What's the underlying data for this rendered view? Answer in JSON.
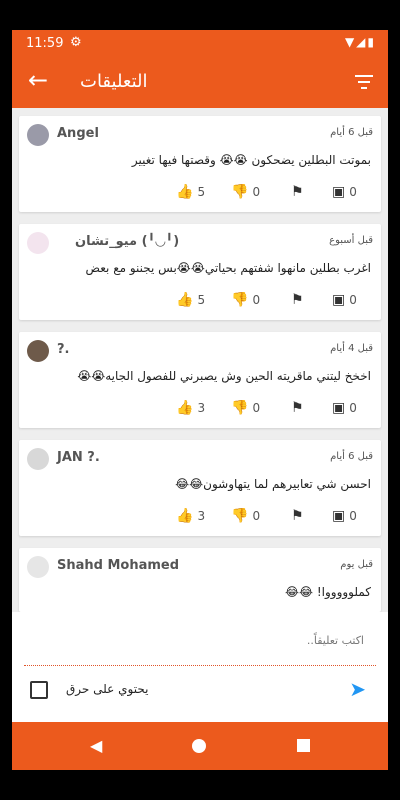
{
  "status_bar": {
    "time": "11:59",
    "system_icons": "▼◢▮"
  },
  "app_bar": {
    "title": "التعليقات"
  },
  "comments": [
    {
      "name": "Angel",
      "time_ago": "قبل 6 أيام",
      "text": "بموتت البطلين يضحكون 😭😭 وقصتها فيها تغيير",
      "likes": "5",
      "dislikes": "0",
      "replies": "0"
    },
    {
      "name": "ميو_تشان (╹◡╹)",
      "time_ago": "قبل أسبوع",
      "text": "اغرب بطلين مانهوا شفتهم بحياتي😭😭بس يجننو مع بعض",
      "likes": "5",
      "dislikes": "0",
      "replies": "0"
    },
    {
      "name": "?.",
      "time_ago": "قبل 4 أيام",
      "text": "اخخخ ليتني ماقريته الحين وش يصبرني للفصول الجايه😭😭",
      "likes": "3",
      "dislikes": "0",
      "replies": "0"
    },
    {
      "name": "JAN ?.",
      "time_ago": "قبل 6 أيام",
      "text": "احسن شي تعابيرهم لما يتهاوشون😂😂",
      "likes": "3",
      "dislikes": "0",
      "replies": "0"
    },
    {
      "name": "Shahd Mohamed",
      "time_ago": "قبل يوم",
      "text": "كملوووووا! 😂😂",
      "likes": "",
      "dislikes": "",
      "replies": ""
    }
  ],
  "composer": {
    "placeholder": "اكتب تعليقاً..",
    "spoiler_label": "يحتوي على حرق"
  },
  "colors": {
    "accent": "#ec5a1d",
    "send": "#2196f3"
  }
}
